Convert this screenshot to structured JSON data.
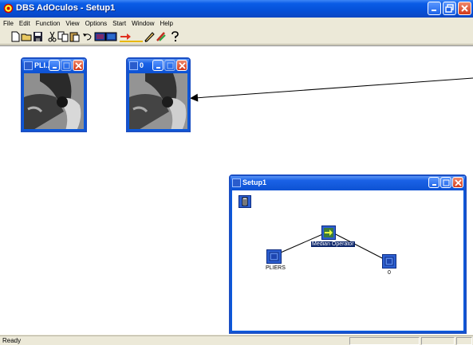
{
  "window": {
    "title": "DBS AdOculos - Setup1"
  },
  "menu": [
    "File",
    "Edit",
    "Function",
    "View",
    "Options",
    "Start",
    "Window",
    "Help"
  ],
  "toolbar_icons": [
    "new-icon",
    "open-icon",
    "save-icon",
    "cut-icon",
    "copy-icon",
    "paste-icon",
    "undo-icon",
    "image-icon",
    "image2-icon",
    "run-arrow-icon",
    "step-icon",
    "pencil-icon",
    "brush-icon",
    "help-icon"
  ],
  "children": {
    "pliers": {
      "title": "PLI..."
    },
    "zero": {
      "title": "0"
    },
    "setup": {
      "title": "Setup1"
    }
  },
  "graph": {
    "source_label": "PLIERS",
    "operator_label": "Median Operator",
    "output_label": "0"
  },
  "status": {
    "text": "Ready"
  }
}
